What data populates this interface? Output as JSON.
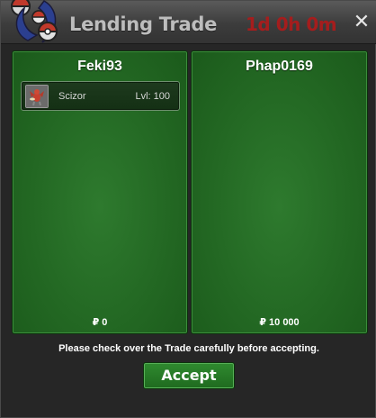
{
  "window": {
    "title": "Lending Trade",
    "timer": "1d 0h 0m",
    "close_label": "✕"
  },
  "panels": {
    "left": {
      "name": "Feki93",
      "money": "₽ 0",
      "items": [
        {
          "name": "Scizor",
          "level": "Lvl: 100",
          "icon": "scizor-sprite-icon"
        }
      ]
    },
    "right": {
      "name": "Phap0169",
      "money": "₽ 10 000",
      "items": []
    }
  },
  "footer": {
    "notice": "Please check over the Trade carefully before accepting.",
    "accept_label": "Accept"
  },
  "colors": {
    "panel_green": "#236823",
    "timer_red": "#a51d1d",
    "title_gray": "#bdbdbd"
  }
}
